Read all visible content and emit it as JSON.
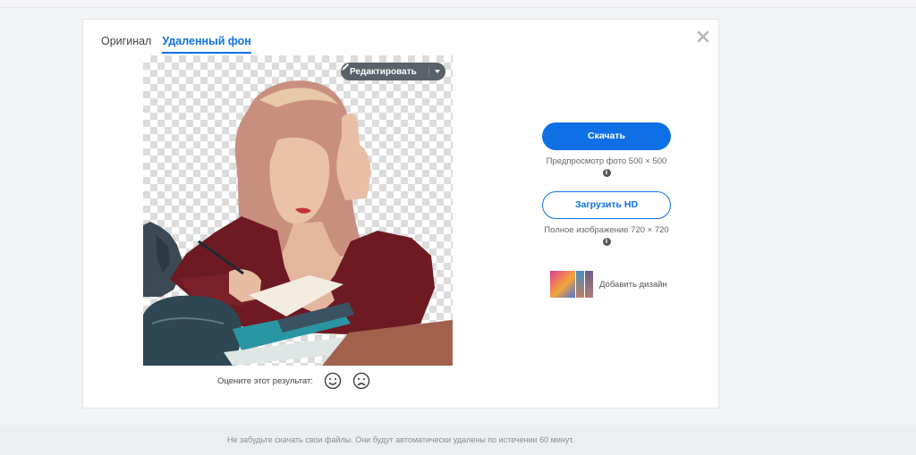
{
  "tabs": {
    "original": "Оригинал",
    "removed_bg": "Удаленный фон"
  },
  "preview": {
    "edit_label": "Редактировать",
    "edit_icon": "brush-icon",
    "checker_color": "#dcdcdc"
  },
  "rating": {
    "label": "Оцените этот результат:",
    "positive_icon": "smile-icon",
    "negative_icon": "frown-icon"
  },
  "actions": {
    "download_label": "Скачать",
    "download_caption": "Предпросмотр фото 500 × 500",
    "hd_label": "Загрузить HD",
    "hd_caption": "Полное изображение 720 × 720",
    "add_design_label": "Добавить дизайн",
    "accent_color": "#0f70e6"
  },
  "footer": {
    "notice": "Не забудьте скачать свои файлы. Они будут автоматически удалены по истечении 60 минут."
  }
}
